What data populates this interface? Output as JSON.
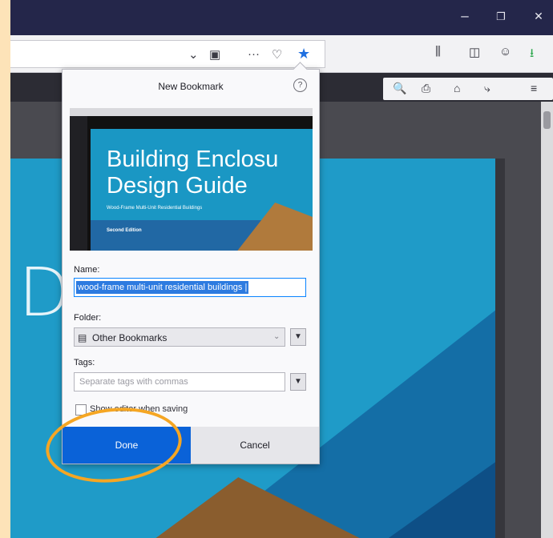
{
  "window": {
    "min_glyph": "–",
    "max_glyph": "❐",
    "close_glyph": "✕"
  },
  "navbar": {
    "dropdown_glyph": "⌄",
    "reader_glyph": "▣",
    "more_glyph": "···",
    "pocket_glyph": "♡",
    "star_glyph": "★",
    "library_glyph": "⫼",
    "sidebar_glyph": "◫",
    "account_glyph": "☺",
    "download_glyph": "⭳"
  },
  "pdf_toolbar": {
    "search_glyph": "🔍",
    "print_glyph": "⎙",
    "save_glyph": "⌂",
    "present_glyph": "⤷",
    "menu_glyph": "≡"
  },
  "page_text": "D S",
  "popup": {
    "title": "New Bookmark",
    "help_glyph": "?",
    "preview": {
      "title_line1": "Building Enclosu",
      "title_line2": "Design Guide",
      "subtitle": "Wood-Frame Multi-Unit Residential Buildings",
      "edition": "Second Edition"
    },
    "name_label": "Name:",
    "name_value": "wood-frame multi-unit residential buildings |",
    "folder_label": "Folder:",
    "folder_value": "Other Bookmarks",
    "tags_label": "Tags:",
    "tags_placeholder": "Separate tags with commas",
    "checkbox_label": "Show editor when saving",
    "done_label": "Done",
    "cancel_label": "Cancel"
  }
}
